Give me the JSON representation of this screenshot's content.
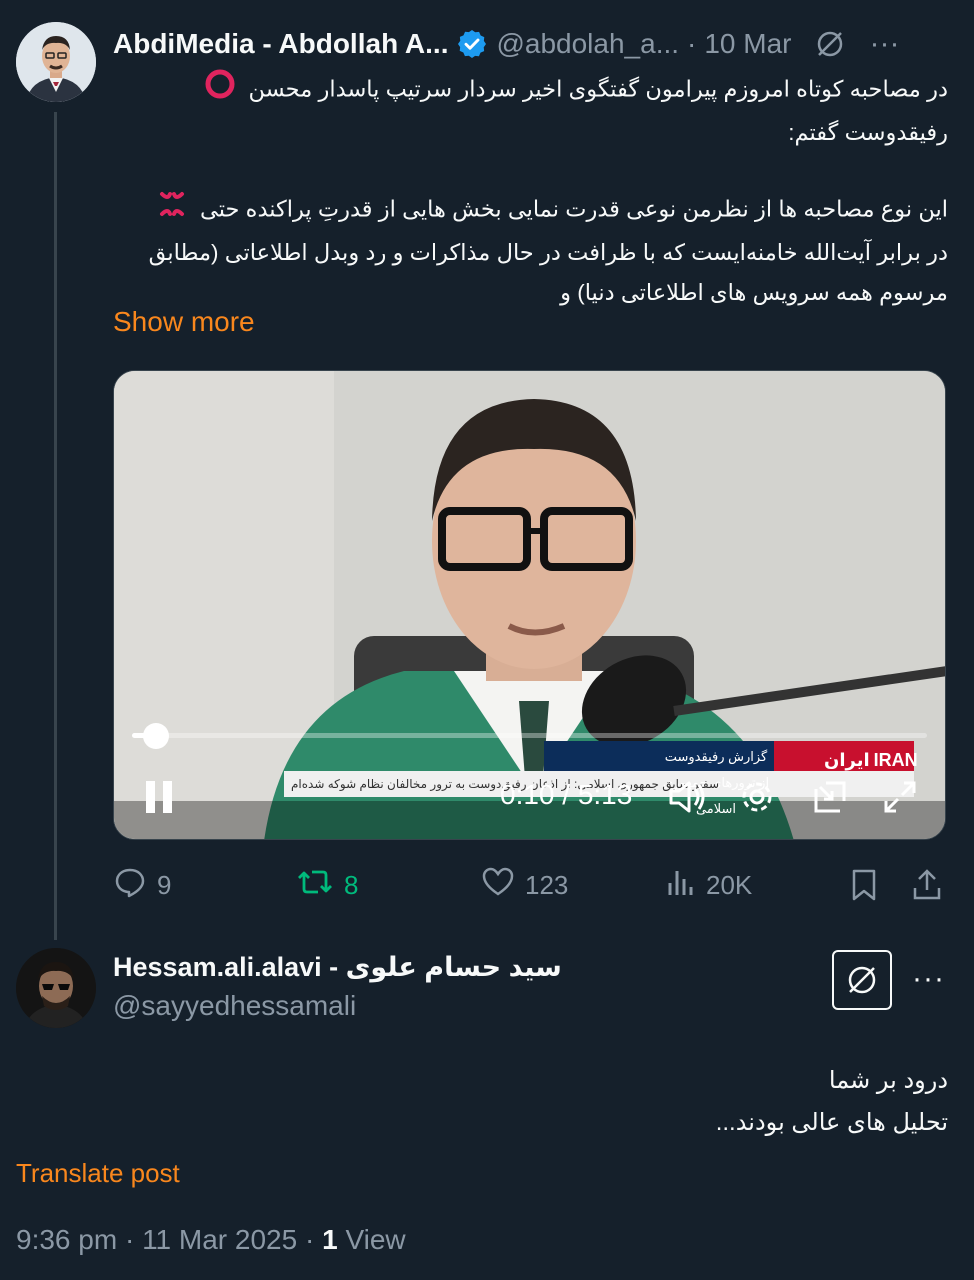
{
  "post": {
    "author_name": "AbdiMedia - Abdollah A...",
    "handle": "@abdolah_a...",
    "date_sep": "·",
    "date": "10 Mar",
    "more": "···",
    "line1": "در مصاحبه کوتاه امروزم پیرامون گفتگوی اخیر سردار سرتیپ پاسدار محسن",
    "line2": "رفیقدوست گفتم:",
    "line3": "این نوع مصاحبه ها از نظرمن نوعی قدرت نمایی بخش هایی از قدرتِ پراکنده حتی",
    "line4": "در برابر آیت‌الله خامنه‌ایست که با ظرافت در حال مذاکرات و رد وبدل اطلاعاتی (مطابق",
    "line5": "مرسوم همه سرویس های اطلاعاتی دنیا) و",
    "show_more": "Show more",
    "video": {
      "time": "0:10 / 5:13",
      "progress": 0.03,
      "channel_logo": "IRAN",
      "channel_logo_fa": "ایران",
      "banner_title": "گزارش رفیقدوست از ترورهای جمهوری اسلامی",
      "ticker": "سفیر سابق جمهوری اسلامی: از اذعان رفیق‌دوست به ترور مخالفان نظام شوکه شده‌ام"
    },
    "stats": {
      "replies": "9",
      "reposts": "8",
      "likes": "123",
      "views": "20K"
    }
  },
  "reply": {
    "author_name": "Hessam.ali.alavi - سید حسام علوی",
    "handle": "@sayyedhessamali",
    "more": "···",
    "line1": "درود بر شما",
    "line2": "تحلیل های عالی بودند...",
    "translate": "Translate post",
    "time": "9:36 pm",
    "sep1": "·",
    "date": "11 Mar 2025",
    "sep2": "·",
    "views_count": "1",
    "views_label": "View"
  },
  "colors": {
    "background": "#15202b",
    "secondary_text": "#8b98a5",
    "accent_orange": "#f9871d",
    "repost_green": "#00ba7c",
    "verified_blue": "#1d9bf0"
  },
  "icons": [
    "red-circle-icon",
    "anger-icon",
    "verified-icon",
    "grok-icon",
    "reply-icon",
    "repost-icon",
    "like-icon",
    "views-icon",
    "bookmark-icon",
    "share-icon",
    "pause-icon",
    "volume-icon",
    "settings-icon",
    "pip-icon",
    "fullscreen-icon"
  ]
}
